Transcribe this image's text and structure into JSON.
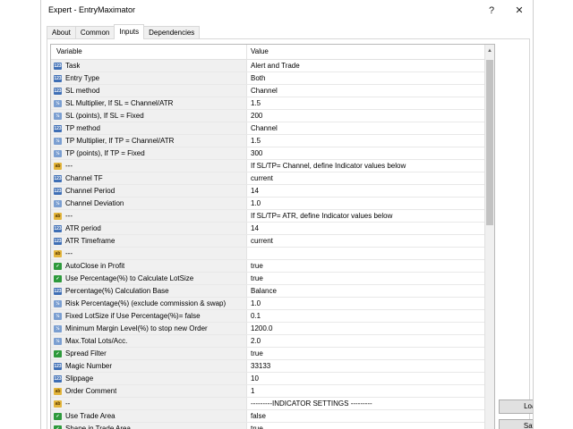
{
  "window": {
    "title": "Expert - EntryMaximator",
    "help_label": "?",
    "close_label": "✕"
  },
  "tabs": [
    "About",
    "Common",
    "Inputs",
    "Dependencies"
  ],
  "active_tab": "Inputs",
  "grid": {
    "col_variable": "Variable",
    "col_value": "Value",
    "rows": [
      {
        "icon": "num",
        "label": "Task",
        "value": "Alert and Trade"
      },
      {
        "icon": "num",
        "label": "Entry Type",
        "value": "Both"
      },
      {
        "icon": "num",
        "label": "SL method",
        "value": "Channel"
      },
      {
        "icon": "dbl",
        "label": "SL Multiplier, If SL = Channel/ATR",
        "value": "1.5"
      },
      {
        "icon": "dbl",
        "label": "SL (points), If SL = Fixed",
        "value": "200"
      },
      {
        "icon": "num",
        "label": "TP method",
        "value": "Channel"
      },
      {
        "icon": "dbl",
        "label": "TP Multiplier, If TP = Channel/ATR",
        "value": "1.5"
      },
      {
        "icon": "dbl",
        "label": "TP (points), If TP = Fixed",
        "value": "300"
      },
      {
        "icon": "ab",
        "label": "---",
        "value": "  If SL/TP= Channel, define Indicator values below"
      },
      {
        "icon": "num",
        "label": "Channel TF",
        "value": "current"
      },
      {
        "icon": "num",
        "label": "Channel Period",
        "value": "14"
      },
      {
        "icon": "dbl",
        "label": "Channel Deviation",
        "value": "1.0"
      },
      {
        "icon": "ab",
        "label": "---",
        "value": "  If SL/TP= ATR, define Indicator values below"
      },
      {
        "icon": "num",
        "label": "ATR period",
        "value": "14"
      },
      {
        "icon": "num",
        "label": "ATR Timeframe",
        "value": "current"
      },
      {
        "icon": "ab",
        "label": "---",
        "value": ""
      },
      {
        "icon": "bool",
        "label": "AutoClose in Profit",
        "value": "true"
      },
      {
        "icon": "bool",
        "label": "Use Percentage(%) to Calculate LotSize",
        "value": "true"
      },
      {
        "icon": "num",
        "label": "Percentage(%) Calculation Base",
        "value": "Balance"
      },
      {
        "icon": "dbl",
        "label": "Risk Percentage(%) (exclude commission & swap)",
        "value": "1.0"
      },
      {
        "icon": "dbl",
        "label": "Fixed LotSize if Use Percentage(%)= false",
        "value": "0.1"
      },
      {
        "icon": "dbl",
        "label": "Minimum Margin Level(%) to stop new Order",
        "value": "1200.0"
      },
      {
        "icon": "dbl",
        "label": "Max.Total Lots/Acc.",
        "value": "2.0"
      },
      {
        "icon": "bool",
        "label": "Spread Filter",
        "value": "true"
      },
      {
        "icon": "num",
        "label": "Magic Number",
        "value": "33133"
      },
      {
        "icon": "num",
        "label": "Slippage",
        "value": "10"
      },
      {
        "icon": "ab",
        "label": "Order Comment",
        "value": "1"
      },
      {
        "icon": "ab",
        "label": "--",
        "value": "---------INDICATOR SETTINGS ---------"
      },
      {
        "icon": "bool",
        "label": "Use Trade Area",
        "value": "false"
      },
      {
        "icon": "bool",
        "label": "Shape in Trade Area",
        "value": "true"
      }
    ]
  },
  "icon_glyphs": {
    "num": "123",
    "dbl": "½",
    "ab": "ab",
    "bool": "✓"
  },
  "buttons": {
    "load": "Load",
    "save": "Save"
  }
}
